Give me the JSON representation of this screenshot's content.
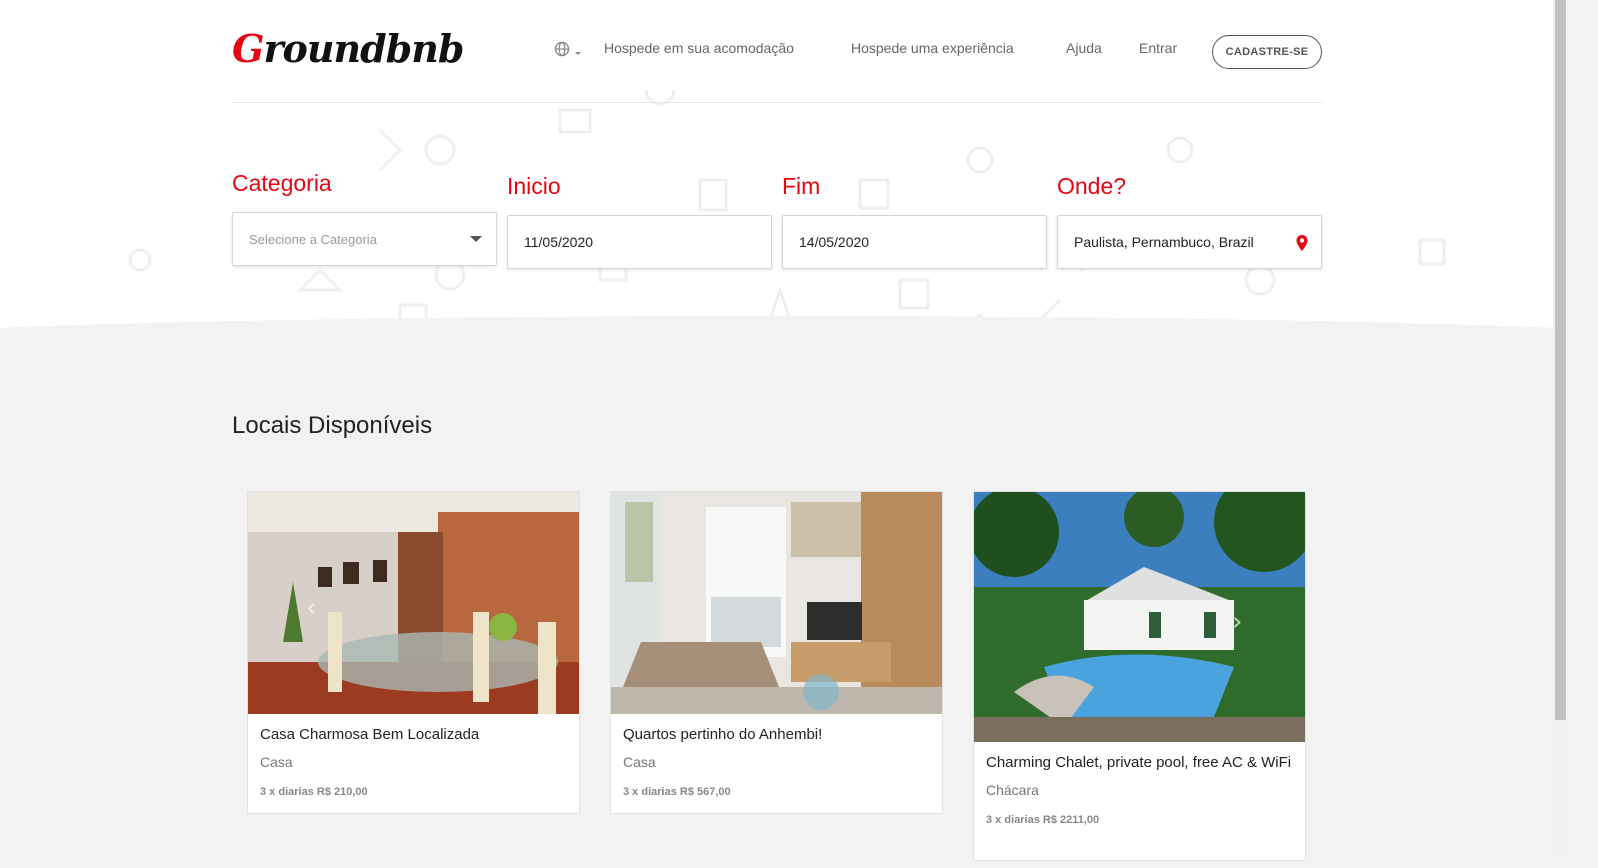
{
  "header": {
    "logo_text": "Groundbnb",
    "nav": [
      {
        "label": "Hospede em sua acomodação"
      },
      {
        "label": "Hospede uma experiência"
      },
      {
        "label": "Ajuda"
      },
      {
        "label": "Entrar"
      }
    ],
    "signup_label": "CADASTRE-SE",
    "language_icon": "globe-icon"
  },
  "search": {
    "category": {
      "label": "Categoria",
      "placeholder": "Selecione a Categoria"
    },
    "start": {
      "label": "Inicio",
      "value": "11/05/2020"
    },
    "end": {
      "label": "Fim",
      "value": "14/05/2020"
    },
    "where": {
      "label": "Onde?",
      "value": "Paulista, Pernambuco, Brazil"
    }
  },
  "listings": {
    "title": "Locais Disponíveis",
    "items": [
      {
        "title": "Casa Charmosa Bem Localizada",
        "category": "Casa",
        "price": "3 x diarias R$ 210,00"
      },
      {
        "title": "Quartos pertinho do Anhembi!",
        "category": "Casa",
        "price": "3 x diarias R$ 567,00"
      },
      {
        "title": "Charming Chalet, private pool, free AC & WiFi",
        "category": "Chácara",
        "price": "3 x diarias R$ 2211,00"
      }
    ]
  },
  "colors": {
    "accent": "#e30613",
    "background": "#f2f2f2"
  }
}
